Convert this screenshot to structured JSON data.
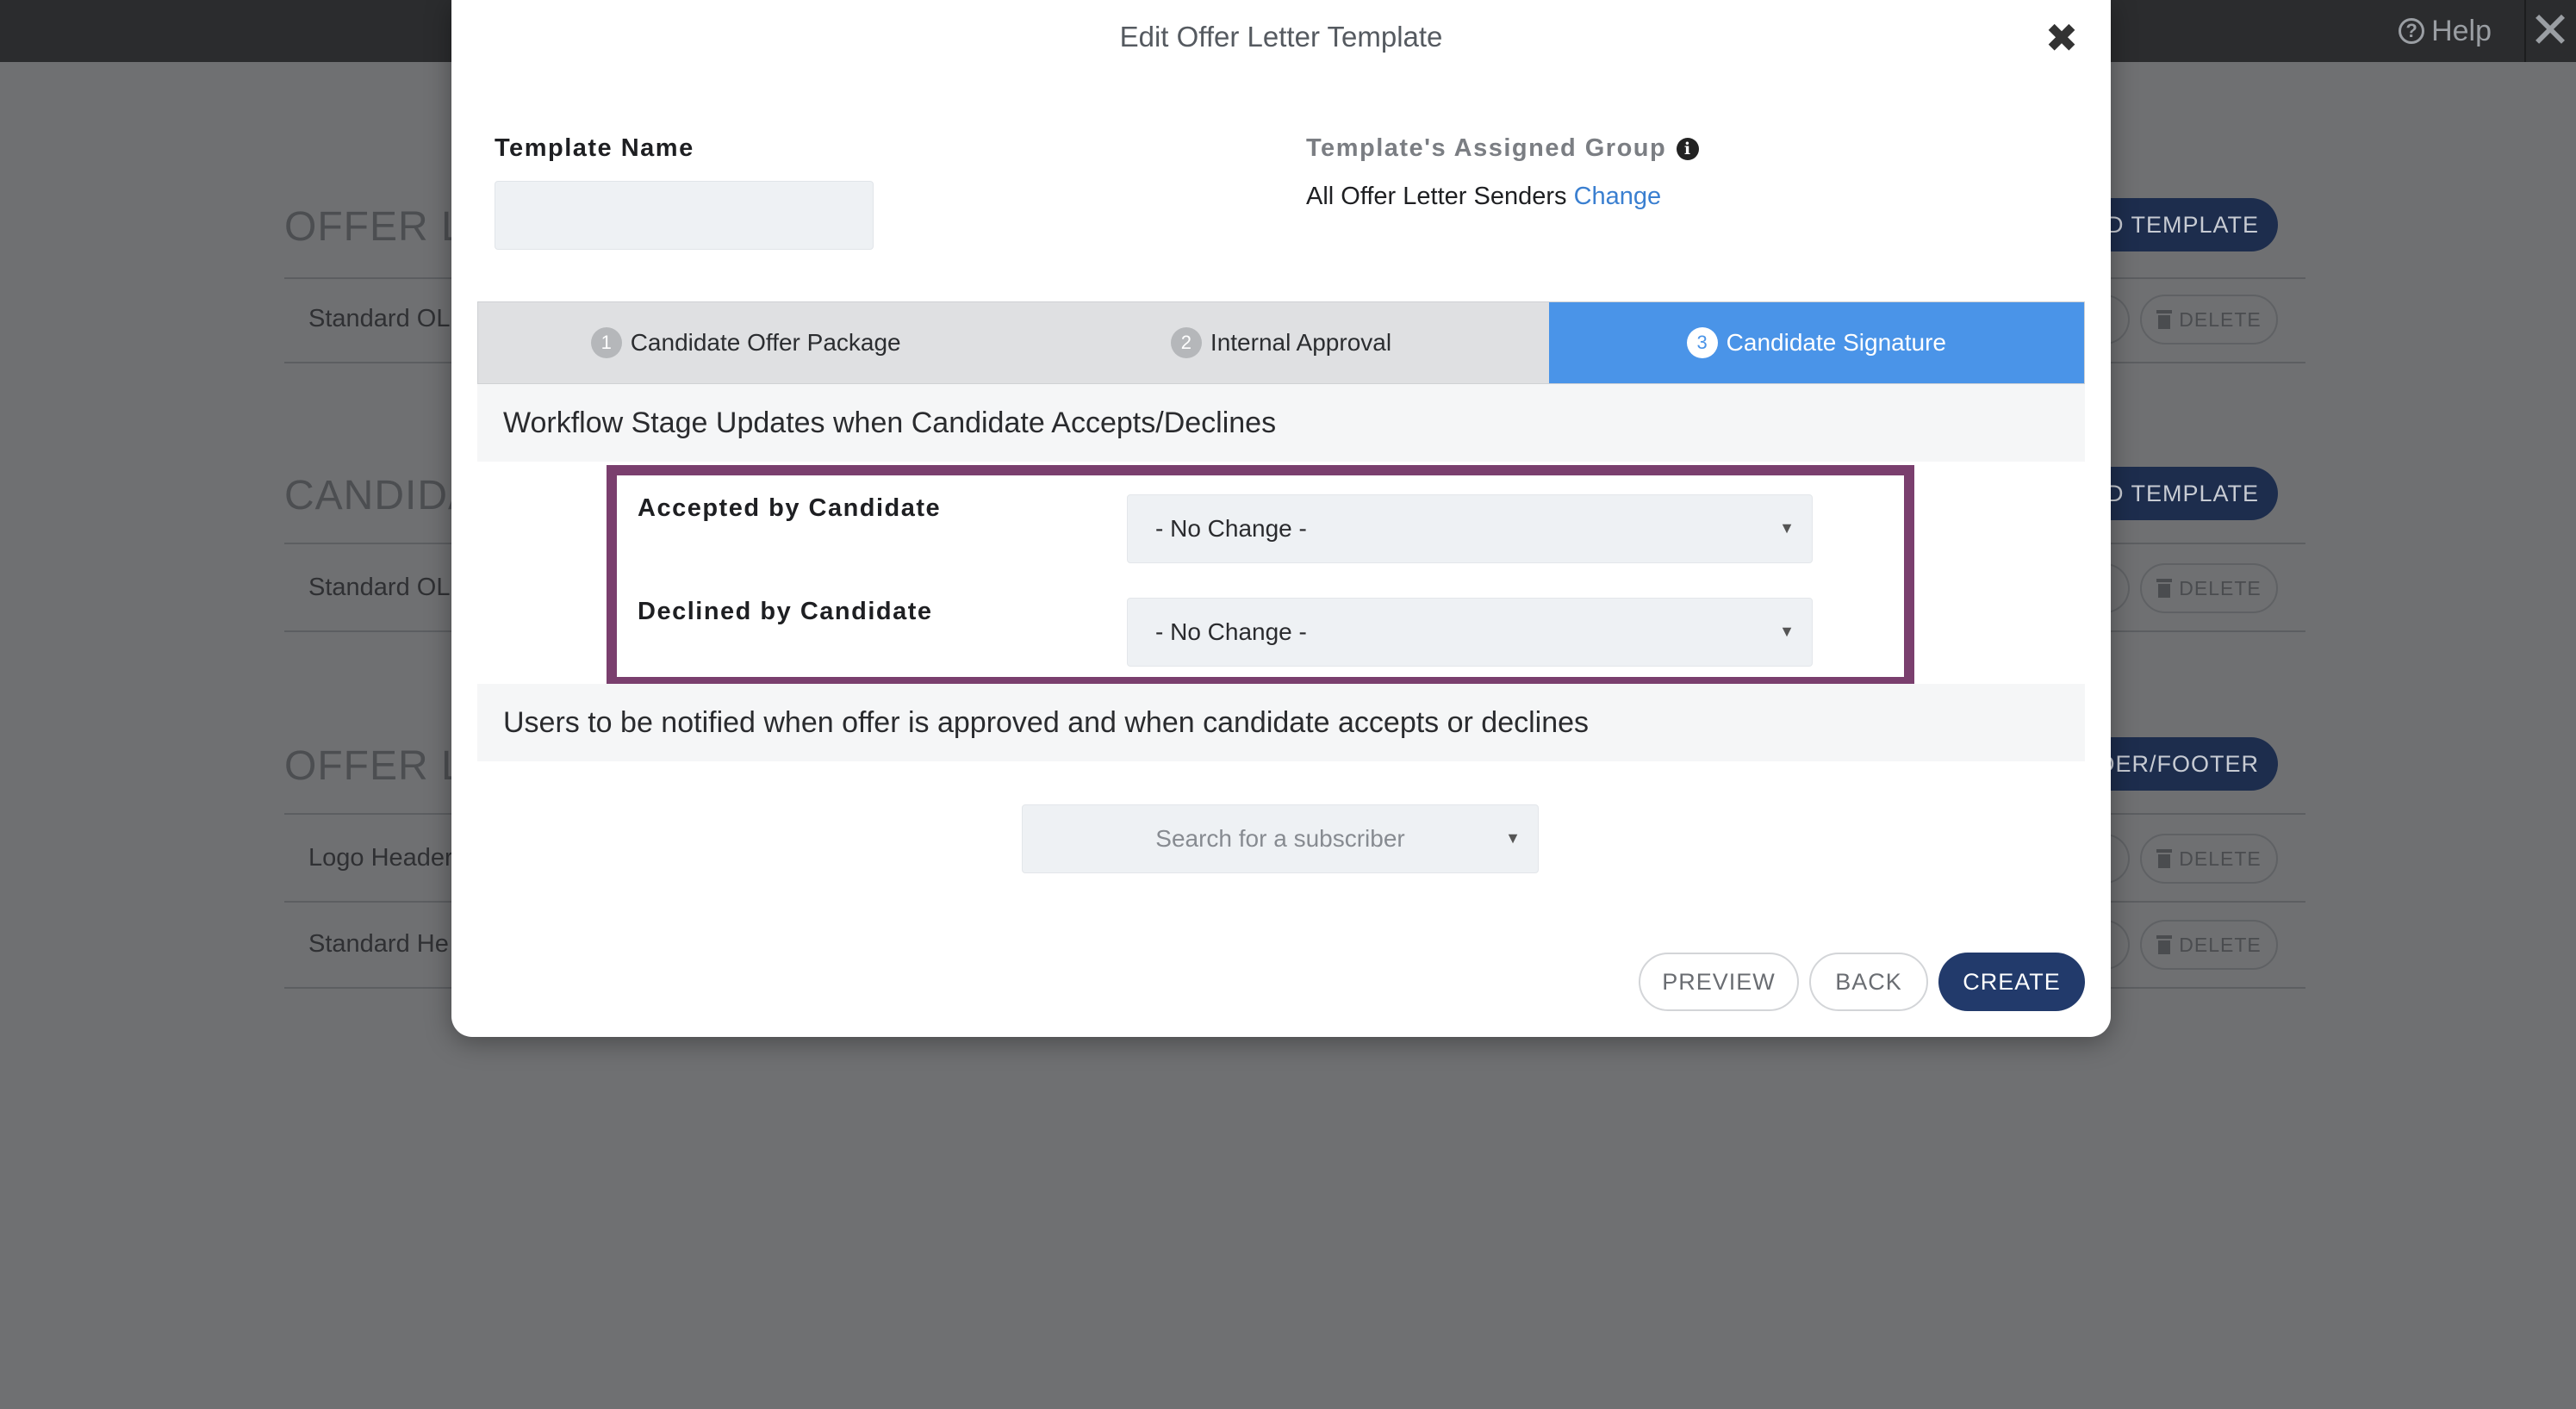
{
  "app": {
    "help_label": "Help",
    "help_icon": "question-circle-icon",
    "close_icon": "close-icon"
  },
  "background": {
    "sections": [
      {
        "title": "OFFER LE",
        "add_button": "D TEMPLATE",
        "rows": [
          "Standard OL"
        ]
      },
      {
        "title": "CANDIDA",
        "add_button": "D TEMPLATE",
        "rows": [
          "Standard OL"
        ]
      },
      {
        "title": "OFFER LE",
        "add_button": "ADER/FOOTER",
        "rows": [
          "Logo Header",
          "Standard He"
        ]
      }
    ],
    "delete_label": "DELETE"
  },
  "modal": {
    "title": "Edit Offer Letter Template",
    "template_name_label": "Template Name",
    "template_name_value": "",
    "assigned_group_label": "Template's Assigned Group",
    "assigned_group_value": "All Offer Letter Senders",
    "change_link": "Change",
    "tabs": [
      {
        "num": "1",
        "label": "Candidate Offer Package",
        "active": false
      },
      {
        "num": "2",
        "label": "Internal Approval",
        "active": false
      },
      {
        "num": "3",
        "label": "Candidate Signature",
        "active": true
      }
    ],
    "workflow_heading": "Workflow Stage Updates when Candidate Accepts/Declines",
    "accepted_label": "Accepted by Candidate",
    "accepted_value": "- No Change -",
    "declined_label": "Declined by Candidate",
    "declined_value": "- No Change -",
    "notify_heading": "Users to be notified when offer is approved and when candidate accepts or declines",
    "subscriber_placeholder": "Search for a subscriber",
    "buttons": {
      "preview": "PREVIEW",
      "back": "BACK",
      "create": "CREATE"
    }
  },
  "colors": {
    "active_tab": "#4a94e8",
    "highlight_border": "#7a3f6e",
    "primary_button": "#223a6b",
    "link": "#3a7fd0"
  }
}
